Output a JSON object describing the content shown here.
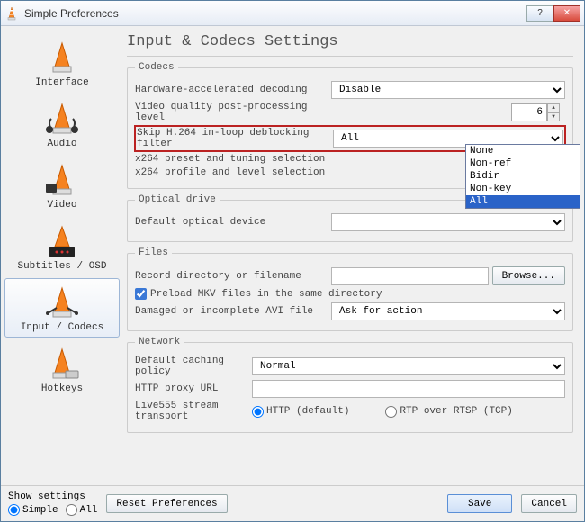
{
  "window": {
    "title": "Simple Preferences"
  },
  "sidebar": {
    "items": [
      {
        "label": "Interface"
      },
      {
        "label": "Audio"
      },
      {
        "label": "Video"
      },
      {
        "label": "Subtitles / OSD"
      },
      {
        "label": "Input / Codecs"
      },
      {
        "label": "Hotkeys"
      }
    ]
  },
  "heading": "Input & Codecs Settings",
  "codecs": {
    "legend": "Codecs",
    "hw_label": "Hardware-accelerated decoding",
    "hw_value": "Disable",
    "pp_label": "Video quality post-processing level",
    "pp_value": "6",
    "skip_label": "Skip H.264 in-loop deblocking filter",
    "skip_value": "All",
    "skip_options": [
      "None",
      "Non-ref",
      "Bidir",
      "Non-key",
      "All"
    ],
    "x264preset_label": "x264 preset and tuning selection",
    "x264profile_label": "x264 profile and level selection"
  },
  "optical": {
    "legend": "Optical drive",
    "device_label": "Default optical device",
    "device_value": ""
  },
  "files": {
    "legend": "Files",
    "record_label": "Record directory or filename",
    "record_value": "",
    "browse": "Browse...",
    "preload_label": "Preload MKV files in the same directory",
    "preload_checked": true,
    "avi_label": "Damaged or incomplete AVI file",
    "avi_value": "Ask for action"
  },
  "network": {
    "legend": "Network",
    "cache_label": "Default caching policy",
    "cache_value": "Normal",
    "proxy_label": "HTTP proxy URL",
    "proxy_value": "",
    "live_label": "Live555 stream transport",
    "live_http": "HTTP (default)",
    "live_rtp": "RTP over RTSP (TCP)"
  },
  "footer": {
    "show_label": "Show settings",
    "show_simple": "Simple",
    "show_all": "All",
    "reset": "Reset Preferences",
    "save": "Save",
    "cancel": "Cancel"
  }
}
